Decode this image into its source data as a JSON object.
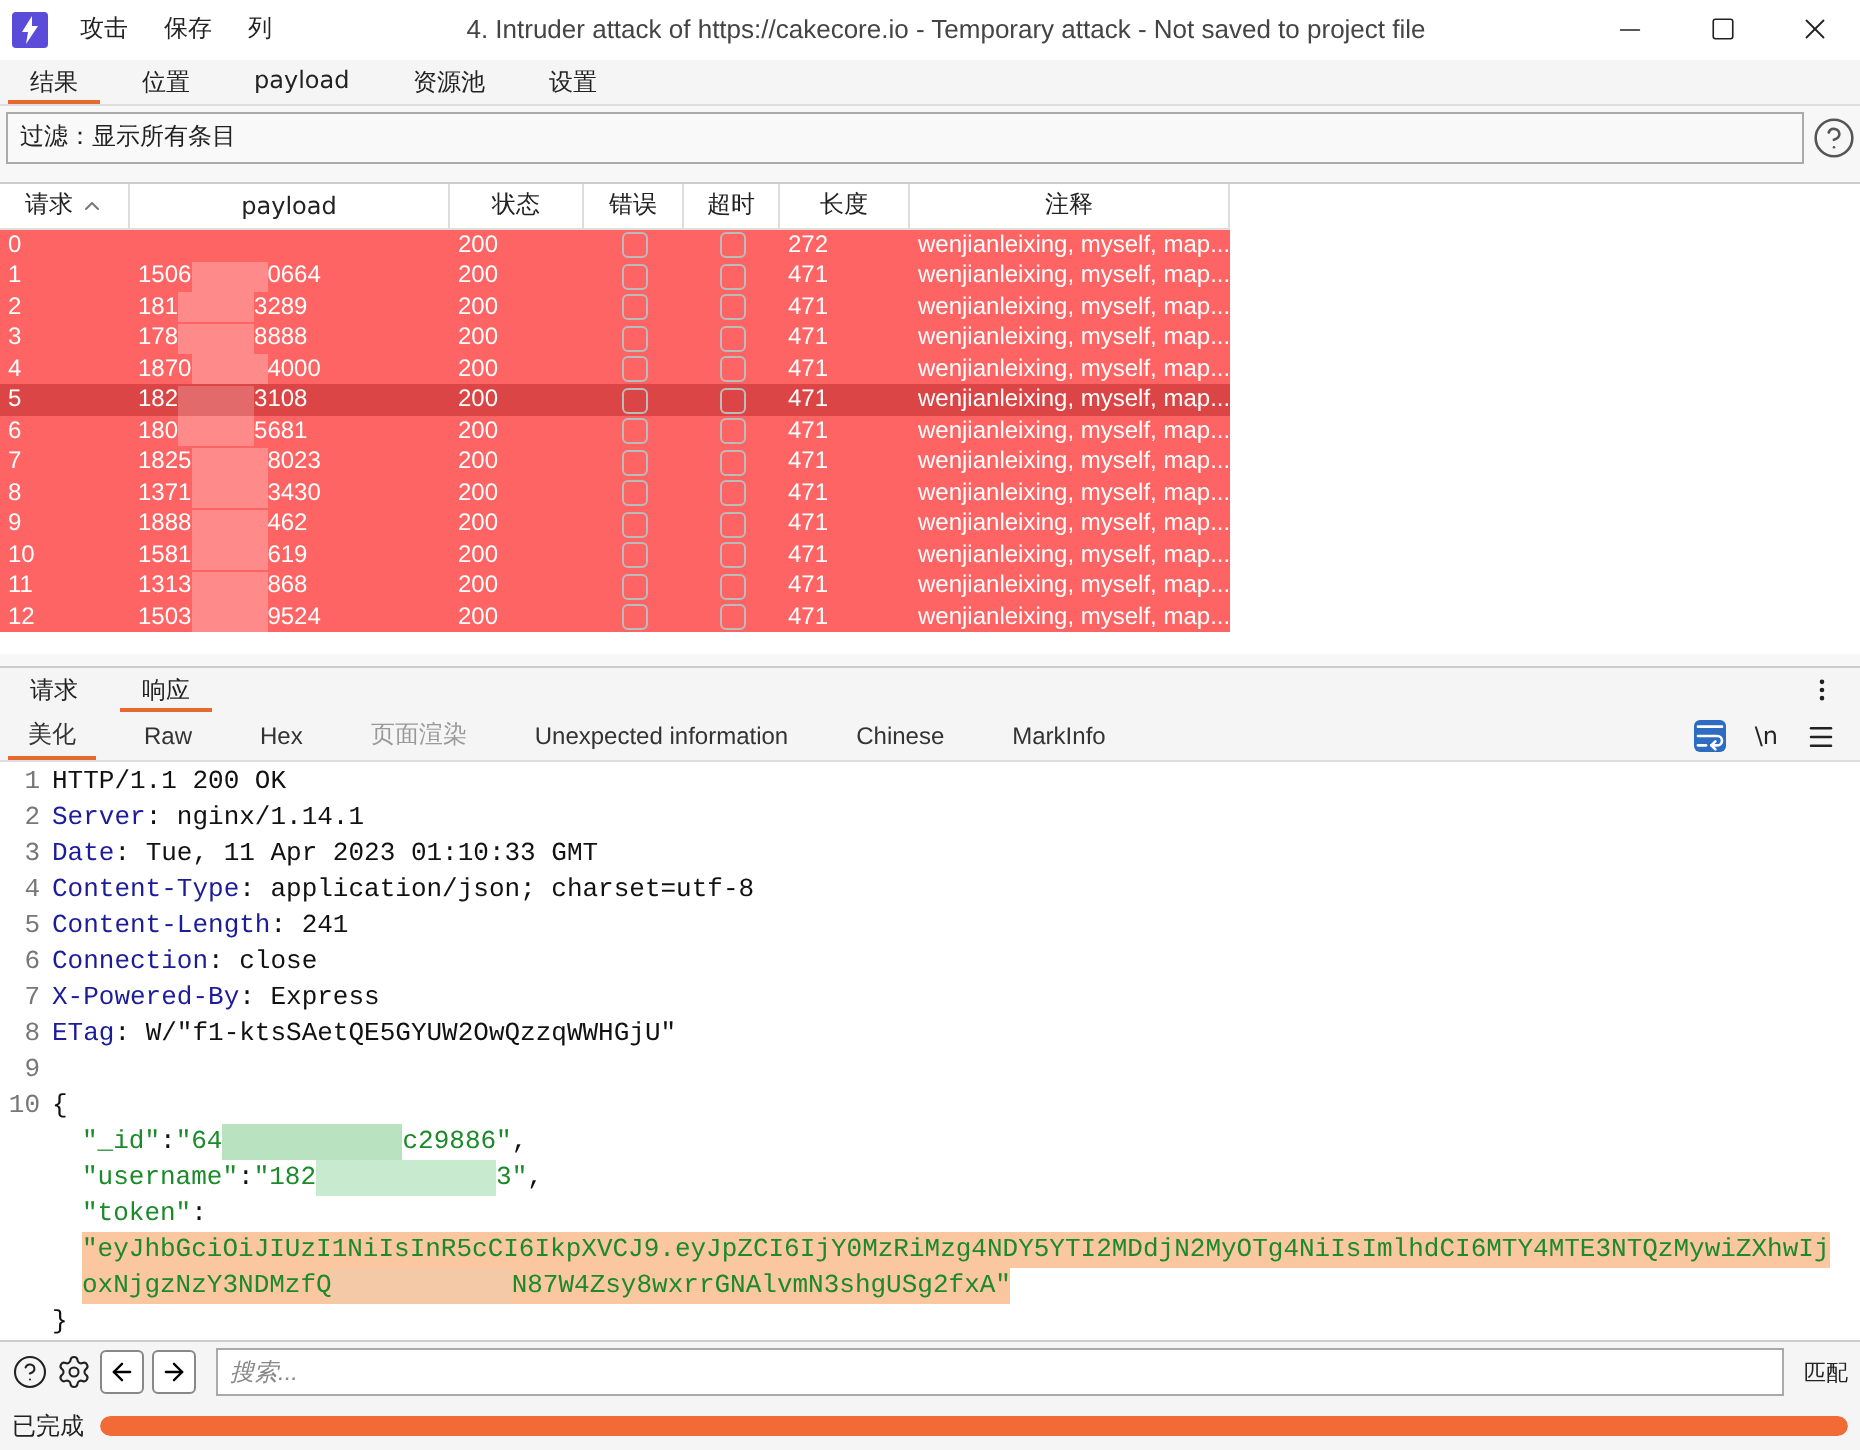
{
  "window": {
    "title": "4. Intruder attack of https://cakecore.io - Temporary attack - Not saved to project file",
    "menu": [
      "攻击",
      "保存",
      "列"
    ]
  },
  "tabs": [
    {
      "label": "结果",
      "selected": true
    },
    {
      "label": "位置",
      "selected": false
    },
    {
      "label": "payload",
      "selected": false
    },
    {
      "label": "资源池",
      "selected": false
    },
    {
      "label": "设置",
      "selected": false
    }
  ],
  "filter": {
    "text": "过滤：显示所有条目"
  },
  "table": {
    "columns": [
      "请求",
      "payload",
      "状态",
      "错误",
      "超时",
      "长度",
      "注释"
    ],
    "rows": [
      {
        "request": "0",
        "payload_start": "",
        "payload_end": "",
        "status": "200",
        "error": false,
        "timeout": false,
        "length": "272",
        "comment": "wenjianleixing, myself, map...",
        "selected": false
      },
      {
        "request": "1",
        "payload_start": "1506",
        "payload_end": "0664",
        "status": "200",
        "error": false,
        "timeout": false,
        "length": "471",
        "comment": "wenjianleixing, myself, map...",
        "selected": false
      },
      {
        "request": "2",
        "payload_start": "181",
        "payload_end": "3289",
        "status": "200",
        "error": false,
        "timeout": false,
        "length": "471",
        "comment": "wenjianleixing, myself, map...",
        "selected": false
      },
      {
        "request": "3",
        "payload_start": "178",
        "payload_end": "8888",
        "status": "200",
        "error": false,
        "timeout": false,
        "length": "471",
        "comment": "wenjianleixing, myself, map...",
        "selected": false
      },
      {
        "request": "4",
        "payload_start": "1870",
        "payload_end": "4000",
        "status": "200",
        "error": false,
        "timeout": false,
        "length": "471",
        "comment": "wenjianleixing, myself, map...",
        "selected": false
      },
      {
        "request": "5",
        "payload_start": "182",
        "payload_end": "3108",
        "status": "200",
        "error": false,
        "timeout": false,
        "length": "471",
        "comment": "wenjianleixing, myself, map...",
        "selected": true
      },
      {
        "request": "6",
        "payload_start": "180",
        "payload_end": "5681",
        "status": "200",
        "error": false,
        "timeout": false,
        "length": "471",
        "comment": "wenjianleixing, myself, map...",
        "selected": false
      },
      {
        "request": "7",
        "payload_start": "1825",
        "payload_end": "8023",
        "status": "200",
        "error": false,
        "timeout": false,
        "length": "471",
        "comment": "wenjianleixing, myself, map...",
        "selected": false
      },
      {
        "request": "8",
        "payload_start": "1371",
        "payload_end": "3430",
        "status": "200",
        "error": false,
        "timeout": false,
        "length": "471",
        "comment": "wenjianleixing, myself, map...",
        "selected": false
      },
      {
        "request": "9",
        "payload_start": "1888",
        "payload_end": "462",
        "status": "200",
        "error": false,
        "timeout": false,
        "length": "471",
        "comment": "wenjianleixing, myself, map...",
        "selected": false
      },
      {
        "request": "10",
        "payload_start": "1581",
        "payload_end": "619",
        "status": "200",
        "error": false,
        "timeout": false,
        "length": "471",
        "comment": "wenjianleixing, myself, map...",
        "selected": false
      },
      {
        "request": "11",
        "payload_start": "1313",
        "payload_end": "868",
        "status": "200",
        "error": false,
        "timeout": false,
        "length": "471",
        "comment": "wenjianleixing, myself, map...",
        "selected": false
      },
      {
        "request": "12",
        "payload_start": "1503",
        "payload_end": "9524",
        "status": "200",
        "error": false,
        "timeout": false,
        "length": "471",
        "comment": "wenjianleixing, myself, map...",
        "selected": false
      }
    ]
  },
  "message_tabs": [
    {
      "label": "请求",
      "selected": false
    },
    {
      "label": "响应",
      "selected": true
    }
  ],
  "view_tabs": [
    {
      "label": "美化",
      "selected": true,
      "disabled": false
    },
    {
      "label": "Raw",
      "selected": false,
      "disabled": false
    },
    {
      "label": "Hex",
      "selected": false,
      "disabled": false
    },
    {
      "label": "页面渲染",
      "selected": false,
      "disabled": true
    },
    {
      "label": "Unexpected information",
      "selected": false,
      "disabled": false
    },
    {
      "label": "Chinese",
      "selected": false,
      "disabled": false
    },
    {
      "label": "MarkInfo",
      "selected": false,
      "disabled": false
    }
  ],
  "newline_toggle": "\\n",
  "code": [
    {
      "number": "1",
      "parts": [
        {
          "kind": "plain",
          "text": "HTTP/1.1 200 OK"
        }
      ]
    },
    {
      "number": "2",
      "parts": [
        {
          "kind": "key",
          "text": "Server"
        },
        {
          "kind": "plain",
          "text": ": nginx/1.14.1"
        }
      ]
    },
    {
      "number": "3",
      "parts": [
        {
          "kind": "key",
          "text": "Date"
        },
        {
          "kind": "plain",
          "text": ": Tue, 11 Apr 2023 01:10:33 GMT"
        }
      ]
    },
    {
      "number": "4",
      "parts": [
        {
          "kind": "key",
          "text": "Content-Type"
        },
        {
          "kind": "plain",
          "text": ": application/json; charset=utf-8"
        }
      ]
    },
    {
      "number": "5",
      "parts": [
        {
          "kind": "key",
          "text": "Content-Length"
        },
        {
          "kind": "plain",
          "text": ": 241"
        }
      ]
    },
    {
      "number": "6",
      "parts": [
        {
          "kind": "key",
          "text": "Connection"
        },
        {
          "kind": "plain",
          "text": ": close"
        }
      ]
    },
    {
      "number": "7",
      "parts": [
        {
          "kind": "key",
          "text": "X-Powered-By"
        },
        {
          "kind": "plain",
          "text": ": Express"
        }
      ]
    },
    {
      "number": "8",
      "parts": [
        {
          "kind": "key",
          "text": "ETag"
        },
        {
          "kind": "plain",
          "text": ": W/\"f1-ktsSAetQE5GYUW2OwQzzqWWHGjU\""
        }
      ]
    },
    {
      "number": "9"
    },
    {
      "number": "10",
      "parts": [
        {
          "kind": "plain",
          "text": "{"
        }
      ],
      "children": [
        {
          "parts": [
            {
              "kind": "string",
              "text": "\"_id\""
            },
            {
              "kind": "plain",
              "text": ":"
            },
            {
              "kind": "string",
              "text": "\"64"
            },
            {
              "kind": "blur",
              "color": "#b9e3c0"
            },
            {
              "kind": "string",
              "text": "c29886\""
            },
            {
              "kind": "plain",
              "text": ","
            }
          ]
        },
        {
          "parts": [
            {
              "kind": "string",
              "text": "\"username\""
            },
            {
              "kind": "plain",
              "text": ":"
            },
            {
              "kind": "string",
              "text": "\"182"
            },
            {
              "kind": "blur",
              "color": "#c8ebcf"
            },
            {
              "kind": "string",
              "text": "3\""
            },
            {
              "kind": "plain",
              "text": ","
            }
          ]
        },
        {
          "parts": [
            {
              "kind": "string",
              "text": "\"token\""
            },
            {
              "kind": "plain",
              "text": ":"
            }
          ]
        },
        {
          "parts": [
            {
              "kind": "token",
              "text": "\"eyJhbGciOiJIUzI1NiIsInR5cCI6IkpXVCJ9.eyJpZCI6IjY0MzRiMzg4NDY5YTI2MDdjN2MyOTg4NiIsImlhdCI6MTY4MTE3NTQzMywiZXhwIj"
            }
          ]
        },
        {
          "parts": [
            {
              "kind": "token",
              "text": "oxNjgzNzY3NDMzfQ"
            },
            {
              "kind": "blur",
              "color": "#f3c9a8"
            },
            {
              "kind": "token",
              "text": "N87W4Zsy8wxrrGNAlvmN3shgUSg2fxA\""
            }
          ]
        }
      ]
    },
    {
      "parts": [
        {
          "kind": "plain",
          "text": "}"
        }
      ]
    }
  ],
  "search": {
    "placeholder": "搜索...",
    "matches": "匹配"
  },
  "status_bar": {
    "text": "已完成",
    "level": 1
  }
}
